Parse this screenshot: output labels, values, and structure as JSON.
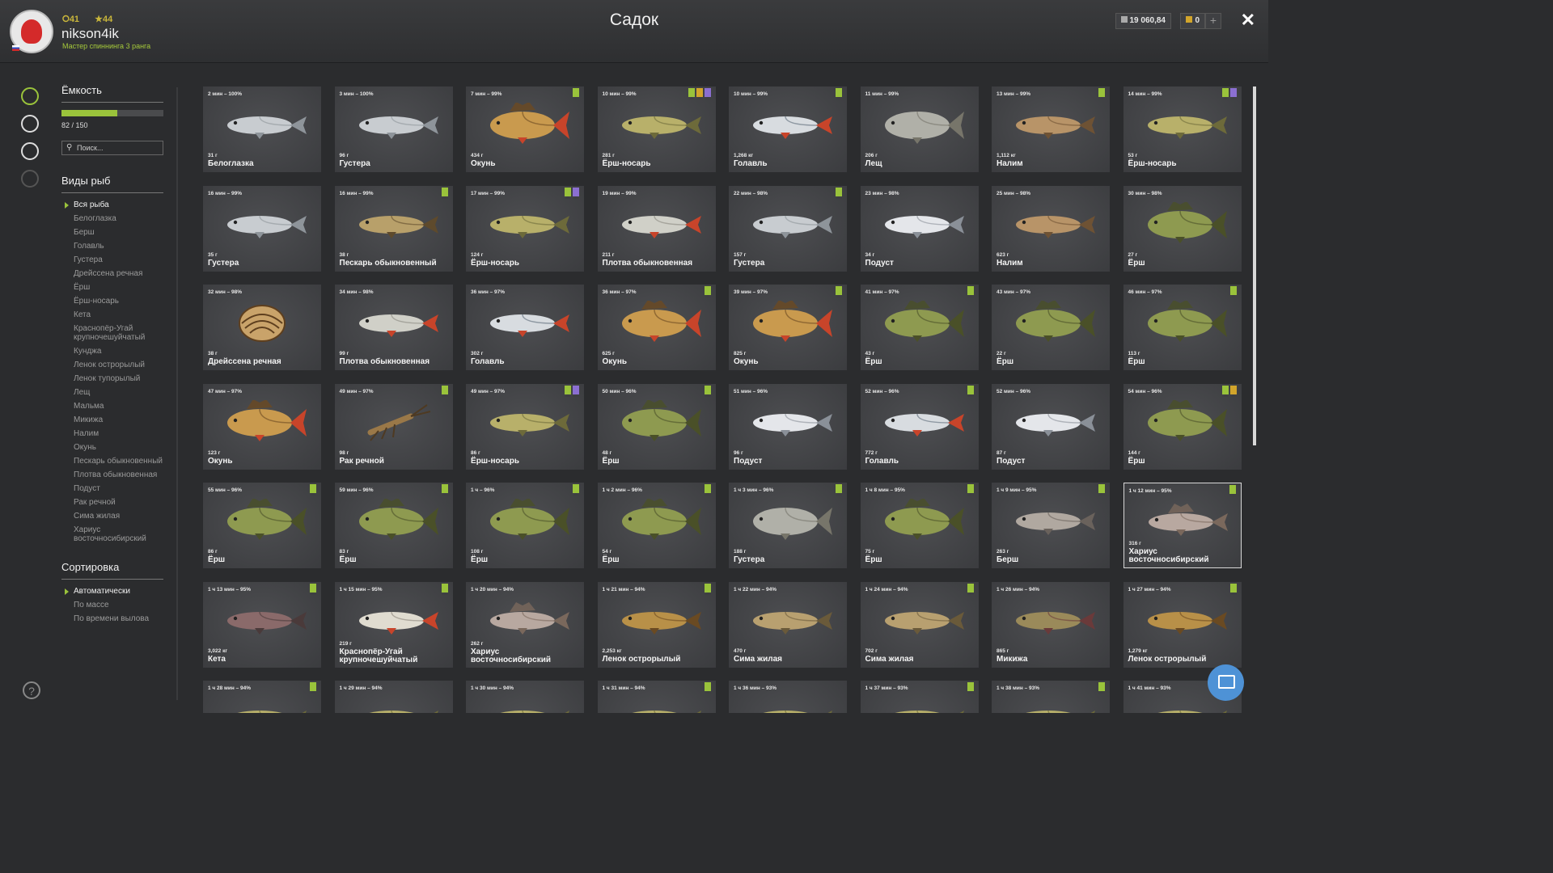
{
  "header": {
    "level_circle": "41",
    "level_star": "44",
    "username": "nikson4ik",
    "rank": "Мастер спиннинга 3 ранга",
    "title": "Садок",
    "money": "19 060,84",
    "gold": "0",
    "plus_label": "+",
    "close_label": "✕"
  },
  "sidebar_icons": [
    "fish-icon",
    "keepnet-icon",
    "camp-icon",
    "home-icon"
  ],
  "help_label": "?",
  "capacity": {
    "title": "Ёмкость",
    "current": 82,
    "max": 150,
    "text": "82 / 150"
  },
  "search": {
    "placeholder": "Поиск..."
  },
  "species": {
    "title": "Виды рыб",
    "items": [
      "Вся рыба",
      "Белоглазка",
      "Берш",
      "Голавль",
      "Густера",
      "Дрейссена речная",
      "Ёрш",
      "Ёрш-носарь",
      "Кета",
      "Краснопёр-Угай крупночешуйчатый",
      "Кунджа",
      "Ленок острорылый",
      "Ленок тупорылый",
      "Лещ",
      "Мальма",
      "Микижа",
      "Налим",
      "Окунь",
      "Пескарь обыкновенный",
      "Плотва обыкновенная",
      "Подуст",
      "Рак речной",
      "Сима жилая",
      "Хариус восточносибирский"
    ],
    "selected": 0
  },
  "sorting": {
    "title": "Сортировка",
    "items": [
      "Автоматически",
      "По массе",
      "По времени вылова"
    ],
    "selected": 0
  },
  "colors": {
    "accent": "#9ac33b",
    "gold": "#d2a52b",
    "purple": "#8b6fd1",
    "chat": "#4e92d6"
  },
  "cards": [
    {
      "time": "2 мин – 100%",
      "weight": "31 г",
      "name": "Белоглазка",
      "badges": [],
      "fish": "silver"
    },
    {
      "time": "3 мин – 100%",
      "weight": "96 г",
      "name": "Густера",
      "badges": [],
      "fish": "silver"
    },
    {
      "time": "7 мин – 99%",
      "weight": "434 г",
      "name": "Окунь",
      "badges": [
        "green"
      ],
      "fish": "perch"
    },
    {
      "time": "10 мин – 99%",
      "weight": "281 г",
      "name": "Ёрш-носарь",
      "badges": [
        "green",
        "gold",
        "purple"
      ],
      "fish": "olive"
    },
    {
      "time": "10 мин – 99%",
      "weight": "1,268 кг",
      "name": "Голавль",
      "badges": [
        "green"
      ],
      "fish": "chub"
    },
    {
      "time": "11 мин – 99%",
      "weight": "206 г",
      "name": "Лещ",
      "badges": [],
      "fish": "bream"
    },
    {
      "time": "13 мин – 99%",
      "weight": "1,112 кг",
      "name": "Налим",
      "badges": [
        "green"
      ],
      "fish": "burbot"
    },
    {
      "time": "14 мин – 99%",
      "weight": "53 г",
      "name": "Ёрш-носарь",
      "badges": [
        "green",
        "purple"
      ],
      "fish": "olive"
    },
    {
      "time": "16 мин – 99%",
      "weight": "35 г",
      "name": "Густера",
      "badges": [],
      "fish": "silver"
    },
    {
      "time": "16 мин – 99%",
      "weight": "38 г",
      "name": "Пескарь обыкновенный",
      "badges": [
        "green"
      ],
      "fish": "gudgeon"
    },
    {
      "time": "17 мин – 99%",
      "weight": "124 г",
      "name": "Ёрш-носарь",
      "badges": [
        "green",
        "purple"
      ],
      "fish": "olive"
    },
    {
      "time": "19 мин – 99%",
      "weight": "211 г",
      "name": "Плотва обыкновенная",
      "badges": [],
      "fish": "roach"
    },
    {
      "time": "22 мин – 98%",
      "weight": "157 г",
      "name": "Густера",
      "badges": [
        "green"
      ],
      "fish": "silver"
    },
    {
      "time": "23 мин – 98%",
      "weight": "34 г",
      "name": "Подуст",
      "badges": [],
      "fish": "white"
    },
    {
      "time": "25 мин – 98%",
      "weight": "623 г",
      "name": "Налим",
      "badges": [],
      "fish": "burbot"
    },
    {
      "time": "30 мин – 98%",
      "weight": "27 г",
      "name": "Ёрш",
      "badges": [],
      "fish": "ruffe"
    },
    {
      "time": "32 мин – 98%",
      "weight": "38 г",
      "name": "Дрейссена речная",
      "badges": [],
      "fish": "shell"
    },
    {
      "time": "34 мин – 98%",
      "weight": "99 г",
      "name": "Плотва обыкновенная",
      "badges": [],
      "fish": "roach"
    },
    {
      "time": "36 мин – 97%",
      "weight": "302 г",
      "name": "Голавль",
      "badges": [],
      "fish": "chub"
    },
    {
      "time": "36 мин – 97%",
      "weight": "625 г",
      "name": "Окунь",
      "badges": [
        "green"
      ],
      "fish": "perch"
    },
    {
      "time": "39 мин – 97%",
      "weight": "825 г",
      "name": "Окунь",
      "badges": [
        "green"
      ],
      "fish": "perch"
    },
    {
      "time": "41 мин – 97%",
      "weight": "43 г",
      "name": "Ёрш",
      "badges": [
        "green"
      ],
      "fish": "ruffe"
    },
    {
      "time": "43 мин – 97%",
      "weight": "22 г",
      "name": "Ёрш",
      "badges": [],
      "fish": "ruffe"
    },
    {
      "time": "46 мин – 97%",
      "weight": "113 г",
      "name": "Ёрш",
      "badges": [
        "green"
      ],
      "fish": "ruffe"
    },
    {
      "time": "47 мин – 97%",
      "weight": "123 г",
      "name": "Окунь",
      "badges": [],
      "fish": "perch"
    },
    {
      "time": "49 мин – 97%",
      "weight": "98 г",
      "name": "Рак речной",
      "badges": [
        "green"
      ],
      "fish": "crayfish"
    },
    {
      "time": "49 мин – 97%",
      "weight": "86 г",
      "name": "Ёрш-носарь",
      "badges": [
        "green",
        "purple"
      ],
      "fish": "olive"
    },
    {
      "time": "50 мин – 96%",
      "weight": "48 г",
      "name": "Ёрш",
      "badges": [
        "green"
      ],
      "fish": "ruffe"
    },
    {
      "time": "51 мин – 96%",
      "weight": "96 г",
      "name": "Подуст",
      "badges": [],
      "fish": "white"
    },
    {
      "time": "52 мин – 96%",
      "weight": "772 г",
      "name": "Голавль",
      "badges": [
        "green"
      ],
      "fish": "chub"
    },
    {
      "time": "52 мин – 96%",
      "weight": "87 г",
      "name": "Подуст",
      "badges": [],
      "fish": "white"
    },
    {
      "time": "54 мин – 96%",
      "weight": "144 г",
      "name": "Ёрш",
      "badges": [
        "green",
        "gold"
      ],
      "fish": "ruffe"
    },
    {
      "time": "55 мин – 96%",
      "weight": "86 г",
      "name": "Ёрш",
      "badges": [
        "green"
      ],
      "fish": "ruffe"
    },
    {
      "time": "59 мин – 96%",
      "weight": "83 г",
      "name": "Ёрш",
      "badges": [
        "green"
      ],
      "fish": "ruffe"
    },
    {
      "time": "1 ч – 96%",
      "weight": "108 г",
      "name": "Ёрш",
      "badges": [
        "green"
      ],
      "fish": "ruffe"
    },
    {
      "time": "1 ч 2 мин – 96%",
      "weight": "54 г",
      "name": "Ёрш",
      "badges": [
        "green"
      ],
      "fish": "ruffe"
    },
    {
      "time": "1 ч 3 мин – 96%",
      "weight": "188 г",
      "name": "Густера",
      "badges": [
        "green"
      ],
      "fish": "bream"
    },
    {
      "time": "1 ч 8 мин – 95%",
      "weight": "75 г",
      "name": "Ёрш",
      "badges": [
        "green"
      ],
      "fish": "ruffe"
    },
    {
      "time": "1 ч 9 мин – 95%",
      "weight": "263 г",
      "name": "Берш",
      "badges": [
        "green"
      ],
      "fish": "pikeperch"
    },
    {
      "time": "1 ч 12 мин – 95%",
      "weight": "316 г",
      "name": "Хариус восточносибирский",
      "badges": [
        "green"
      ],
      "fish": "grayling",
      "selected": true
    },
    {
      "time": "1 ч 13 мин – 95%",
      "weight": "3,022 кг",
      "name": "Кета",
      "badges": [
        "green"
      ],
      "fish": "salmon"
    },
    {
      "time": "1 ч 15 мин – 95%",
      "weight": "219 г",
      "name": "Краснопёр-Угай крупночешуйчатый",
      "badges": [
        "green"
      ],
      "fish": "ugai"
    },
    {
      "time": "1 ч 20 мин – 94%",
      "weight": "262 г",
      "name": "Хариус восточносибирский",
      "badges": [],
      "fish": "grayling"
    },
    {
      "time": "1 ч 21 мин – 94%",
      "weight": "2,253 кг",
      "name": "Ленок острорылый",
      "badges": [
        "green"
      ],
      "fish": "lenok"
    },
    {
      "time": "1 ч 22 мин – 94%",
      "weight": "470 г",
      "name": "Сима жилая",
      "badges": [],
      "fish": "trout"
    },
    {
      "time": "1 ч 24 мин – 94%",
      "weight": "702 г",
      "name": "Сима жилая",
      "badges": [
        "green"
      ],
      "fish": "trout"
    },
    {
      "time": "1 ч 26 мин – 94%",
      "weight": "865 г",
      "name": "Микижа",
      "badges": [],
      "fish": "rainbow"
    },
    {
      "time": "1 ч 27 мин – 94%",
      "weight": "1,279 кг",
      "name": "Ленок острорылый",
      "badges": [
        "green"
      ],
      "fish": "lenok"
    },
    {
      "time": "1 ч 28 мин – 94%",
      "weight": "",
      "name": "",
      "badges": [
        "green"
      ],
      "fish": "olive"
    },
    {
      "time": "1 ч 29 мин – 94%",
      "weight": "",
      "name": "",
      "badges": [],
      "fish": "olive"
    },
    {
      "time": "1 ч 30 мин – 94%",
      "weight": "",
      "name": "",
      "badges": [],
      "fish": "olive"
    },
    {
      "time": "1 ч 31 мин – 94%",
      "weight": "",
      "name": "",
      "badges": [
        "green"
      ],
      "fish": "olive"
    },
    {
      "time": "1 ч 36 мин – 93%",
      "weight": "",
      "name": "",
      "badges": [],
      "fish": "olive"
    },
    {
      "time": "1 ч 37 мин – 93%",
      "weight": "",
      "name": "",
      "badges": [
        "green"
      ],
      "fish": "olive"
    },
    {
      "time": "1 ч 38 мин – 93%",
      "weight": "",
      "name": "",
      "badges": [
        "green"
      ],
      "fish": "olive"
    },
    {
      "time": "1 ч 41 мин – 93%",
      "weight": "",
      "name": "",
      "badges": [],
      "fish": "olive"
    }
  ]
}
